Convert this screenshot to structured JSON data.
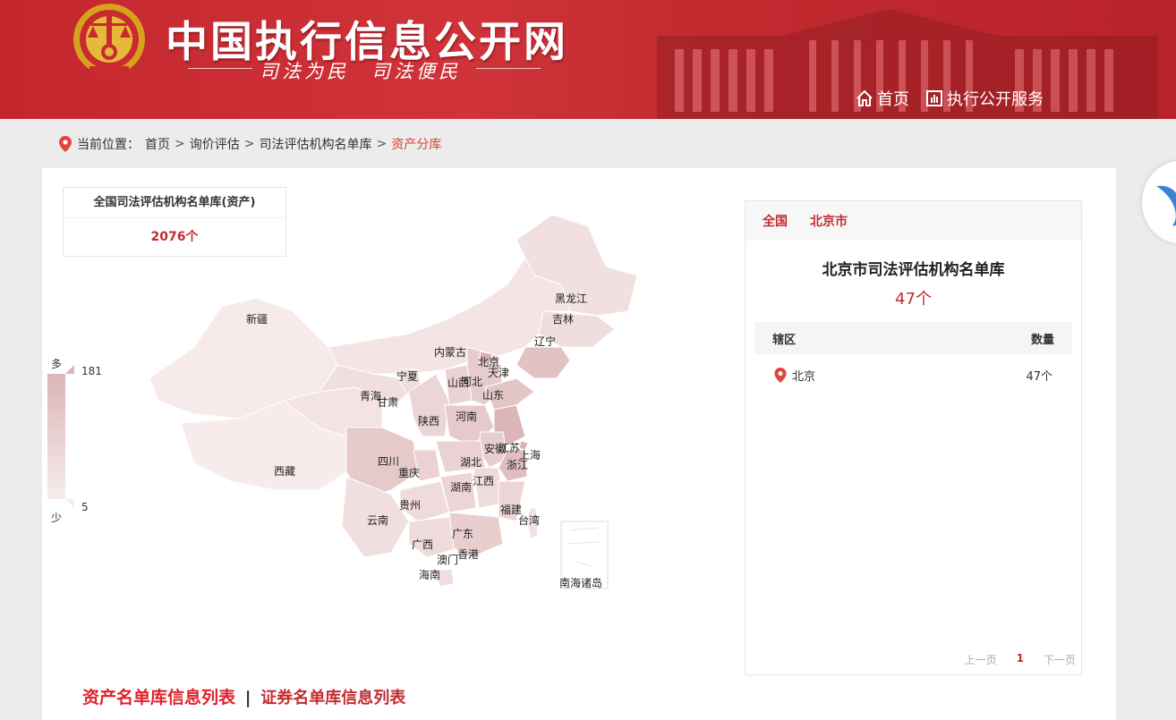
{
  "header": {
    "site_title": "中国执行信息公开网",
    "slogan": "司法为民　司法便民",
    "nav": [
      {
        "label": "首页",
        "icon": "home-icon"
      },
      {
        "label": "执行公开服务",
        "icon": "chart-icon"
      }
    ]
  },
  "breadcrumb": {
    "prefix": "当前位置：",
    "items": [
      "首页",
      "询价评估",
      "司法评估机构名单库"
    ],
    "current": "资产分库",
    "separator": ">"
  },
  "summary": {
    "title": "全国司法评估机构名单库(资产)",
    "count": "2076个"
  },
  "legend": {
    "high_word": "多",
    "low_word": "少",
    "max": "181",
    "min": "5"
  },
  "map": {
    "provinces": [
      "黑龙江",
      "吉林",
      "辽宁",
      "新疆",
      "内蒙古",
      "北京",
      "天津",
      "宁夏",
      "山西",
      "河北",
      "青海",
      "甘肃",
      "山东",
      "陕西",
      "河南",
      "江苏",
      "安徽",
      "上海",
      "西藏",
      "四川",
      "重庆",
      "湖北",
      "浙江",
      "湖南",
      "江西",
      "云南",
      "贵州",
      "福建",
      "台湾",
      "广西",
      "广东",
      "澳门",
      "香港",
      "海南",
      "南海诸岛"
    ]
  },
  "right_panel": {
    "tabs": [
      "全国",
      "北京市"
    ],
    "title": "北京市司法评估机构名单库",
    "count": "47个",
    "table_headers": [
      "辖区",
      "数量"
    ],
    "rows": [
      {
        "region": "北京",
        "count": "47个"
      }
    ],
    "pager": {
      "prev": "上一页",
      "current": "1",
      "next": "下一页"
    }
  },
  "lists": {
    "asset": "资产名单库信息列表",
    "separator": "|",
    "securities": "证券名单库信息列表"
  },
  "colors": {
    "header_red": "#c4262d",
    "accent_red": "#c32b32",
    "map_fill_light": "#f5e6e6",
    "map_fill_dark": "#dbb5b7"
  }
}
